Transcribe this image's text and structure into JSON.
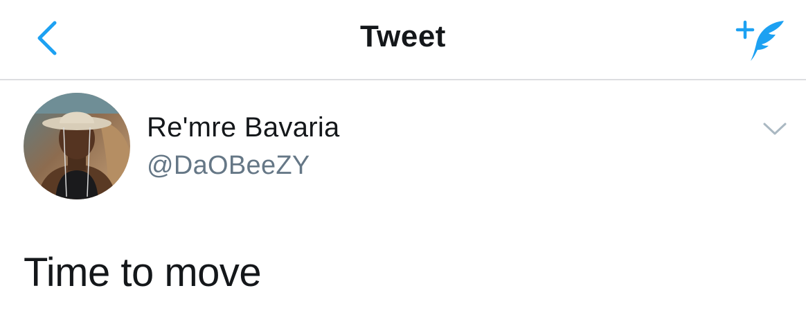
{
  "nav": {
    "title": "Tweet",
    "back_icon": "chevron-left-icon",
    "compose_icon": "compose-tweet-icon",
    "accent_color": "#1da1f2"
  },
  "tweet": {
    "author": {
      "display_name": "Re'mre Bavaria",
      "handle": "@DaOBeeZY"
    },
    "text": "Time to move",
    "menu_icon": "chevron-down-icon"
  }
}
